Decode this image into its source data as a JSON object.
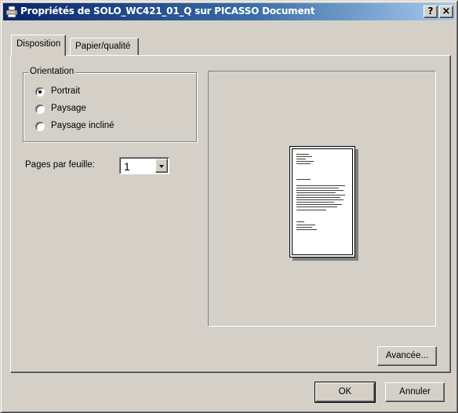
{
  "window": {
    "title": "Propriétés de SOLO_WC421_01_Q sur PICASSO Document",
    "help_label": "?",
    "close_label": "×"
  },
  "tabs": [
    {
      "label": "Disposition",
      "active": true
    },
    {
      "label": "Papier/qualité",
      "active": false
    }
  ],
  "orientation": {
    "legend": "Orientation",
    "options": [
      {
        "label": "Portrait",
        "selected": true
      },
      {
        "label": "Paysage",
        "selected": false
      },
      {
        "label": "Paysage incliné",
        "selected": false
      }
    ]
  },
  "pages_per_sheet": {
    "label": "Pages par feuille:",
    "value": "1"
  },
  "buttons": {
    "advanced": "Avancée...",
    "ok": "OK",
    "cancel": "Annuler"
  },
  "icons": {
    "title": "printer-icon",
    "dropdown": "chevron-down-icon"
  }
}
